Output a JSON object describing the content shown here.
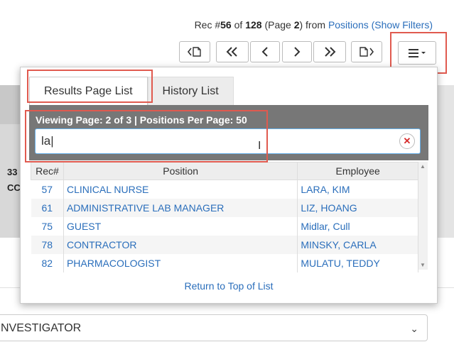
{
  "header": {
    "rec_prefix": "Rec #",
    "rec_num": "56",
    "of": "of",
    "total": "128",
    "page_open": "(Page",
    "page": "2",
    "page_close": ")",
    "from": "from",
    "source_link": "Positions",
    "filters_link": "(Show Filters)"
  },
  "nav": {
    "icons": [
      "first-page-icon",
      "double-left-icon",
      "left-icon",
      "right-icon",
      "double-right-icon",
      "last-page-icon"
    ],
    "menu_icon": "hamburger-menu-icon"
  },
  "background": {
    "frag_1": "33",
    "frag_2": "CC",
    "select_value": "NVESTIGATOR"
  },
  "popup": {
    "tabs": [
      {
        "label": "Results Page List",
        "active": true
      },
      {
        "label": "History List",
        "active": false
      }
    ],
    "viewing": "Viewing Page: 2 of 3  |  Positions Per Page: 50",
    "filter_value": "la",
    "columns": [
      "Rec#",
      "Position",
      "Employee"
    ],
    "rows": [
      {
        "rec": "57",
        "position": "CLINICAL NURSE",
        "employee": "LARA, KIM"
      },
      {
        "rec": "61",
        "position": "ADMINISTRATIVE LAB MANAGER",
        "employee": "LIZ, HOANG"
      },
      {
        "rec": "75",
        "position": "GUEST",
        "employee": "Midlar, Cull"
      },
      {
        "rec": "78",
        "position": "CONTRACTOR",
        "employee": "MINSKY, CARLA"
      },
      {
        "rec": "82",
        "position": "PHARMACOLOGIST",
        "employee": "MULATU, TEDDY"
      }
    ],
    "return_link": "Return to Top of List"
  },
  "colors": {
    "link": "#2a6ebb",
    "highlight": "#e05a4f",
    "panel": "#777777"
  }
}
